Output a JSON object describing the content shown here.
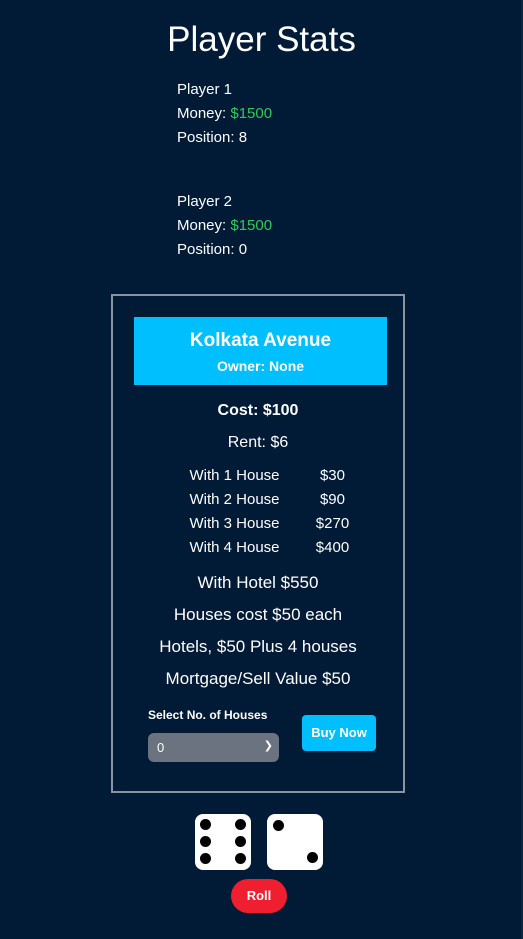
{
  "page_title": "Player Stats",
  "players": [
    {
      "name": "Player 1",
      "money_label": "Money: ",
      "money": "$1500",
      "position": "Position: 8"
    },
    {
      "name": "Player 2",
      "money_label": "Money: ",
      "money": "$1500",
      "position": "Position: 0"
    }
  ],
  "property": {
    "name": "Kolkata Avenue",
    "owner": "Owner: None",
    "cost": "Cost: $100",
    "rent": "Rent: $6",
    "house_rents": [
      {
        "label": "With 1 House",
        "value": "$30"
      },
      {
        "label": "With 2 House",
        "value": "$90"
      },
      {
        "label": "With 3 House",
        "value": "$270"
      },
      {
        "label": "With 4 House",
        "value": "$400"
      }
    ],
    "hotel": "With Hotel $550",
    "houses_cost": "Houses cost $50 each",
    "hotels_cost": "Hotels, $50 Plus 4 houses",
    "mortgage": "Mortgage/Sell Value $50",
    "select_label": "Select No. of Houses",
    "select_value": "0",
    "buy_label": "Buy Now"
  },
  "dice": [
    6,
    2
  ],
  "roll_label": "Roll",
  "colors": {
    "background": "#011a35",
    "accent": "#00bfff",
    "money": "#2ecc5a",
    "roll": "#ef1f2f"
  }
}
